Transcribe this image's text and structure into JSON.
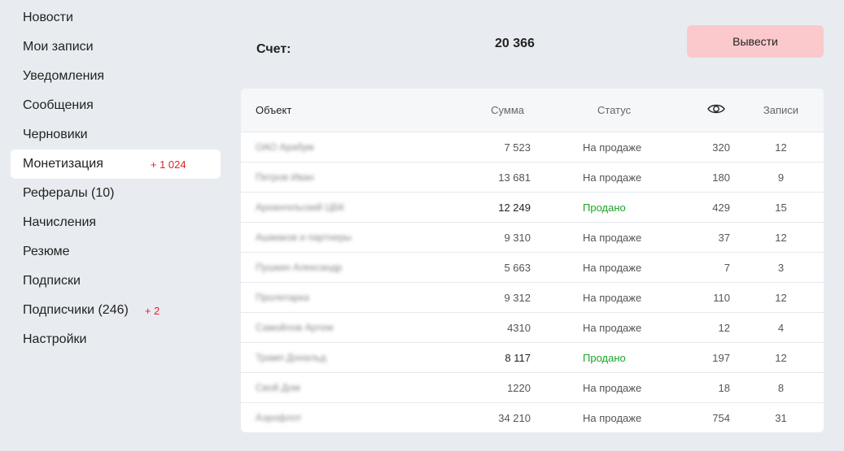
{
  "sidebar": {
    "items": [
      {
        "label": "Новости"
      },
      {
        "label": "Мои записи"
      },
      {
        "label": "Уведомления"
      },
      {
        "label": "Сообщения"
      },
      {
        "label": "Черновики"
      },
      {
        "label": "Монетизация",
        "badge": "+ 1 024",
        "active": true
      },
      {
        "label": "Рефералы (10)"
      },
      {
        "label": "Начисления"
      },
      {
        "label": "Резюме"
      },
      {
        "label": "Подписки"
      },
      {
        "label": "Подписчики (246)",
        "badge": "+ 2"
      },
      {
        "label": "Настройки"
      }
    ]
  },
  "balance": {
    "label": "Счет:",
    "value": "20 366"
  },
  "withdraw_button": {
    "label": "Вывести",
    "color": "#fbc9cc"
  },
  "table": {
    "headers": {
      "object": "Объект",
      "sum": "Сумма",
      "status": "Статус",
      "views_icon": "eye-icon",
      "posts": "Записи"
    },
    "rows": [
      {
        "object": "ОАО Арабум",
        "sum": "7 523",
        "status": "На продаже",
        "views": "320",
        "posts": "12"
      },
      {
        "object": "Петров Иван",
        "sum": "13 681",
        "status": "На продаже",
        "views": "180",
        "posts": "9"
      },
      {
        "object": "Архангельский ЦБК",
        "sum": "12 249",
        "status": "Продано",
        "views": "429",
        "posts": "15"
      },
      {
        "object": "Ашмаков и партнеры",
        "sum": "9 310",
        "status": "На продаже",
        "views": "37",
        "posts": "12"
      },
      {
        "object": "Пушкин Александр",
        "sum": "5 663",
        "status": "На продаже",
        "views": "7",
        "posts": "3"
      },
      {
        "object": "Пролетарка",
        "sum": "9 312",
        "status": "На продаже",
        "views": "110",
        "posts": "12"
      },
      {
        "object": "Самойлов Артем",
        "sum": "4310",
        "status": "На продаже",
        "views": "12",
        "posts": "4"
      },
      {
        "object": "Трамп Дональд",
        "sum": "8 117",
        "status": "Продано",
        "views": "197",
        "posts": "12"
      },
      {
        "object": "Свой Дом",
        "sum": "1220",
        "status": "На продаже",
        "views": "18",
        "posts": "8"
      },
      {
        "object": "Аэрофлот",
        "sum": "34 210",
        "status": "На продаже",
        "views": "754",
        "posts": "31"
      }
    ]
  },
  "colors": {
    "background": "#e8ecf0",
    "sold": "#1aa52a",
    "badge": "#e0202a"
  }
}
